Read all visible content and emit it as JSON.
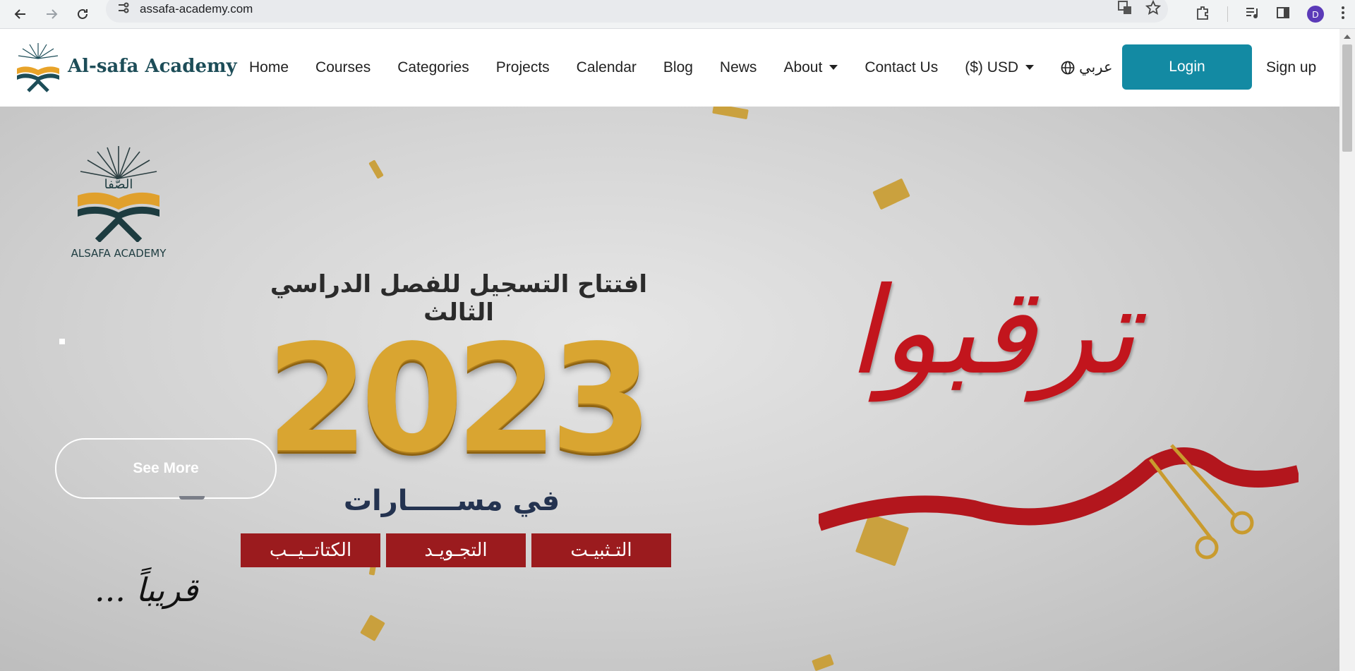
{
  "browser": {
    "url": "assafa-academy.com",
    "profile_initial": "D"
  },
  "header": {
    "brand": "Al-safa Academy",
    "nav": {
      "home": "Home",
      "courses": "Courses",
      "categories": "Categories",
      "projects": "Projects",
      "calendar": "Calendar",
      "blog": "Blog",
      "news": "News",
      "about": "About",
      "contact": "Contact Us",
      "currency": "($) USD",
      "language": "عربي"
    },
    "login": "Login",
    "signup": "Sign up"
  },
  "hero": {
    "logo_caption": "ALSAFA ACADEMY",
    "logo_arabic": "الصَّفا",
    "headline": "افتتاح التسجيل للفصل الدراسي الثالث",
    "year": "2023",
    "subtitle": "في مســـــارات",
    "tags": [
      "التـثبيـت",
      "التجـويـد",
      "الكتاتــيــب"
    ],
    "soon": "قريباً ...",
    "calligraphy": "ترقبوا",
    "cta": "See More"
  },
  "colors": {
    "brand_teal": "#138aa3",
    "brand_dark": "#1d4d58",
    "gold": "#d9a531",
    "red": "#9b1b1e"
  }
}
